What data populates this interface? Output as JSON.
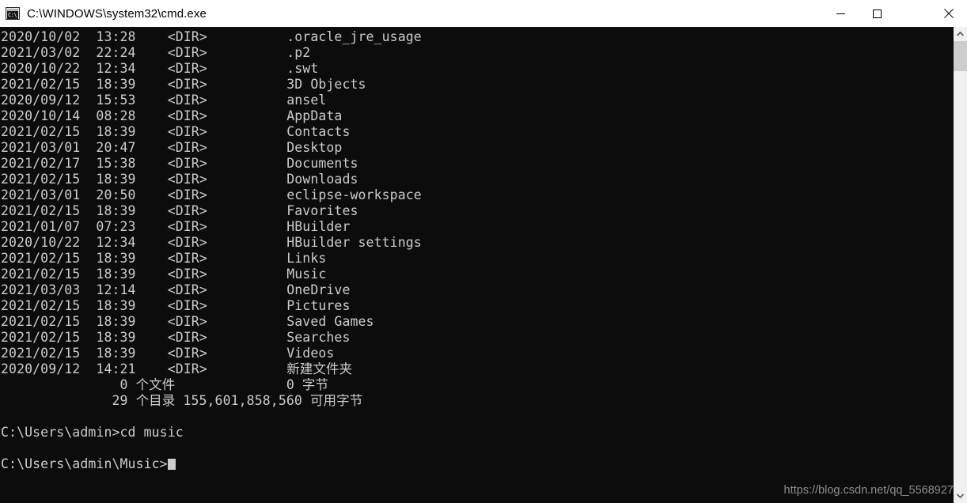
{
  "window": {
    "title": "C:\\WINDOWS\\system32\\cmd.exe",
    "icon": "cmd-icon",
    "background_color": "#0c0c0c",
    "text_color": "#cccccc",
    "titlebar_color": "#ffffff",
    "controls": {
      "minimize": "minimize",
      "maximize": "maximize",
      "close": "close"
    }
  },
  "console": {
    "lines": [
      "2020/10/02  13:28    <DIR>          .oracle_jre_usage",
      "2021/03/02  22:24    <DIR>          .p2",
      "2020/10/22  12:34    <DIR>          .swt",
      "2021/02/15  18:39    <DIR>          3D Objects",
      "2020/09/12  15:53    <DIR>          ansel",
      "2020/10/14  08:28    <DIR>          AppData",
      "2021/02/15  18:39    <DIR>          Contacts",
      "2021/03/01  20:47    <DIR>          Desktop",
      "2021/02/17  15:38    <DIR>          Documents",
      "2021/02/15  18:39    <DIR>          Downloads",
      "2021/03/01  20:50    <DIR>          eclipse-workspace",
      "2021/02/15  18:39    <DIR>          Favorites",
      "2021/01/07  07:23    <DIR>          HBuilder",
      "2020/10/22  12:34    <DIR>          HBuilder settings",
      "2021/02/15  18:39    <DIR>          Links",
      "2021/02/15  18:39    <DIR>          Music",
      "2021/03/03  12:14    <DIR>          OneDrive",
      "2021/02/15  18:39    <DIR>          Pictures",
      "2021/02/15  18:39    <DIR>          Saved Games",
      "2021/02/15  18:39    <DIR>          Searches",
      "2021/02/15  18:39    <DIR>          Videos",
      "2020/09/12  14:21    <DIR>          新建文件夹",
      "               0 个文件              0 字节",
      "              29 个目录 155,601,858,560 可用字节",
      "",
      "C:\\Users\\admin>cd music",
      "",
      "C:\\Users\\admin\\Music>"
    ],
    "prompt_current": "C:\\Users\\admin\\Music>",
    "command_entered": "cd music",
    "summary_files": "0 个文件",
    "summary_bytes": "0 字节",
    "summary_dirs": "29 个目录",
    "summary_free_bytes": "155,601,858,560 可用字节"
  },
  "watermark": {
    "text": "https://blog.csdn.net/qq_5568927"
  },
  "scrollbar": {
    "up_arrow": "chevron-up-icon",
    "down_arrow": "chevron-down-icon",
    "thumb": "scrollbar-thumb"
  }
}
